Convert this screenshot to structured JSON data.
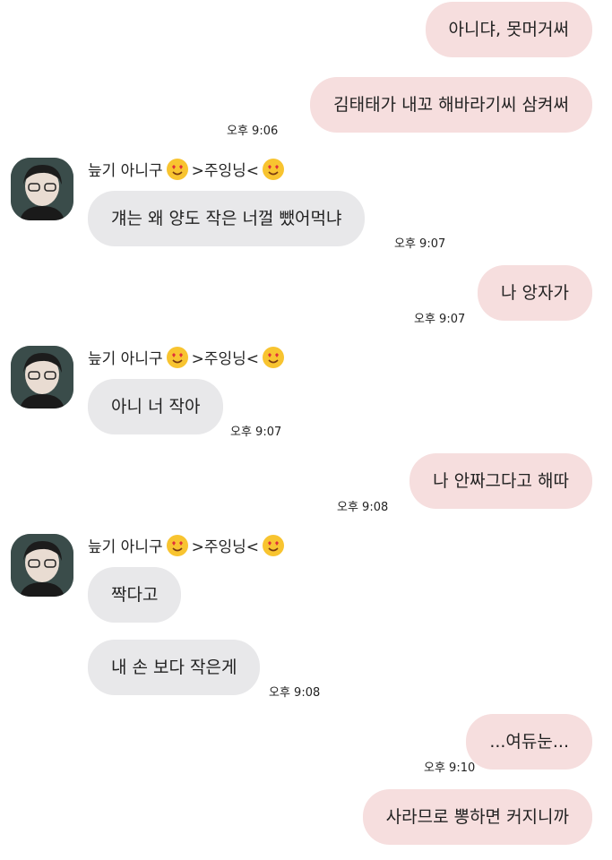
{
  "chat": {
    "sender_name_prefix": "늪기 아니구",
    "sender_name_suffix": ">주잉닝<",
    "sender_name_emoji": "heart-eyes-emoji",
    "colors": {
      "my_bubble": "#f6dede",
      "their_bubble": "#e8e8ea"
    },
    "messages": [
      {
        "from": "me",
        "text": "아니댜, 못머거써"
      },
      {
        "from": "me",
        "text": "김태태가 내꼬 해바라기씨 삼켜써",
        "time": "오후 9:06"
      },
      {
        "from": "them",
        "text": "걔는 왜 양도 작은 너껄 뺐어먹냐",
        "time": "오후 9:07"
      },
      {
        "from": "me",
        "text": "나 앙자가",
        "time": "오후 9:07"
      },
      {
        "from": "them",
        "text": "아니 너 작아",
        "time": "오후 9:07"
      },
      {
        "from": "me",
        "text": "나 안짜그다고 해따",
        "time": "오후 9:08"
      },
      {
        "from": "them",
        "text": "짝다고"
      },
      {
        "from": "them",
        "text": "내 손 보다 작은게",
        "time": "오후 9:08"
      },
      {
        "from": "me",
        "text": "...여듀눈...",
        "time": "오후 9:10"
      },
      {
        "from": "me",
        "text": "사라므로 뽕하면 커지니까"
      }
    ]
  }
}
